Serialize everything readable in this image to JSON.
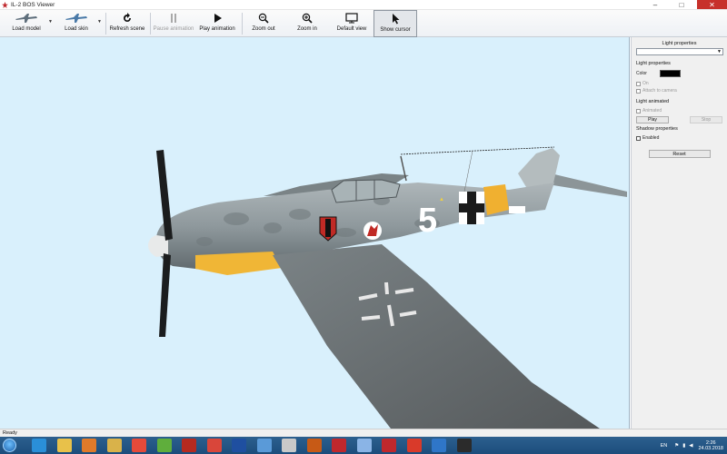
{
  "window": {
    "title": "IL-2 BOS Viewer",
    "minimize": "–",
    "maximize": "□",
    "close": "✕"
  },
  "toolbar": {
    "load_model": "Load model",
    "load_skin": "Load skin",
    "refresh_scene": "Refresh scene",
    "pause_animation": "Pause animation",
    "play_animation": "Play animation",
    "zoom_out": "Zoom out",
    "zoom_in": "Zoom in",
    "default_view": "Default view",
    "show_cursor": "Show cursor"
  },
  "viewport": {
    "fuselage_number": "5"
  },
  "panel": {
    "header": "Light properties",
    "light_properties_label": "Light properties",
    "color_label": "Color",
    "on_label": "On",
    "attach_label": "Attach to camera",
    "light_animated_label": "Light animated",
    "animated_label": "Animated",
    "play_button": "Play",
    "stop_button": "Stop",
    "shadow_properties_label": "Shadow properties",
    "enabled_label": "Enabled",
    "reset_button": "Reset",
    "light_color": "#000000"
  },
  "status": {
    "text": "Ready"
  },
  "taskbar": {
    "language": "EN",
    "time": "2:26",
    "date": "24.03.2018",
    "icons": [
      "ie-icon",
      "folder-icon",
      "media-icon",
      "explorer-icon",
      "chrome-icon",
      "app-icon",
      "flash-builder-icon",
      "pdf-icon",
      "photoshop-icon",
      "pen-icon",
      "doc-icon",
      "illustrator-icon",
      "il2-icon",
      "itunes-icon",
      "red-star-icon",
      "flash-icon",
      "word-icon",
      "7zip-icon"
    ]
  }
}
